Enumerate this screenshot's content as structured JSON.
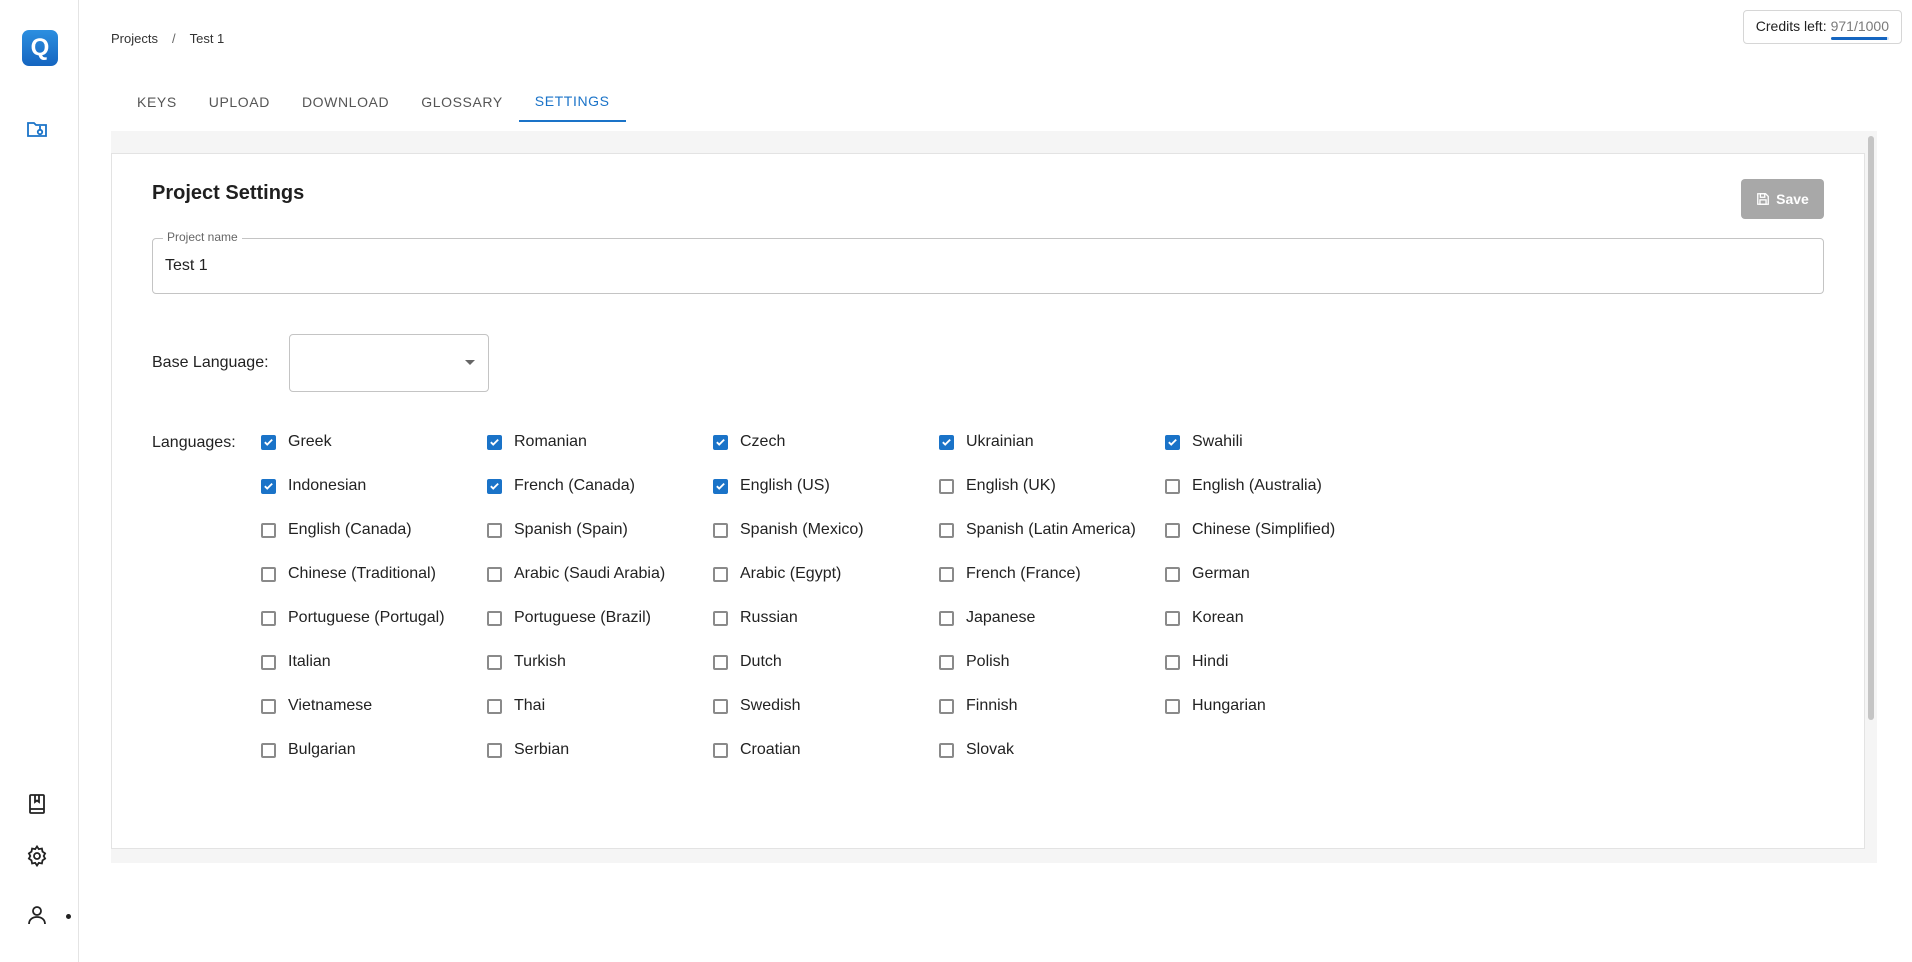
{
  "app": {
    "logo_letter": "Q"
  },
  "breadcrumb": {
    "projects": "Projects",
    "separator": "/",
    "current": "Test 1"
  },
  "credits": {
    "label": "Credits left:",
    "value": "971/1000",
    "fraction_used": 0.971
  },
  "tabs": [
    {
      "label": "KEYS",
      "active": false
    },
    {
      "label": "UPLOAD",
      "active": false
    },
    {
      "label": "DOWNLOAD",
      "active": false
    },
    {
      "label": "GLOSSARY",
      "active": false
    },
    {
      "label": "SETTINGS",
      "active": true
    }
  ],
  "settings": {
    "title": "Project Settings",
    "save_label": "Save",
    "project_name_legend": "Project name",
    "project_name_value": "Test 1",
    "base_language_label": "Base Language:",
    "base_language_value": "",
    "languages_label": "Languages:"
  },
  "languages": [
    {
      "name": "Greek",
      "checked": true
    },
    {
      "name": "Romanian",
      "checked": true
    },
    {
      "name": "Czech",
      "checked": true
    },
    {
      "name": "Ukrainian",
      "checked": true
    },
    {
      "name": "Swahili",
      "checked": true
    },
    {
      "name": "Indonesian",
      "checked": true
    },
    {
      "name": "French (Canada)",
      "checked": true
    },
    {
      "name": "English (US)",
      "checked": true
    },
    {
      "name": "English (UK)",
      "checked": false
    },
    {
      "name": "English (Australia)",
      "checked": false
    },
    {
      "name": "English (Canada)",
      "checked": false
    },
    {
      "name": "Spanish (Spain)",
      "checked": false
    },
    {
      "name": "Spanish (Mexico)",
      "checked": false
    },
    {
      "name": "Spanish (Latin America)",
      "checked": false
    },
    {
      "name": "Chinese (Simplified)",
      "checked": false
    },
    {
      "name": "Chinese (Traditional)",
      "checked": false
    },
    {
      "name": "Arabic (Saudi Arabia)",
      "checked": false
    },
    {
      "name": "Arabic (Egypt)",
      "checked": false
    },
    {
      "name": "French (France)",
      "checked": false
    },
    {
      "name": "German",
      "checked": false
    },
    {
      "name": "Portuguese (Portugal)",
      "checked": false
    },
    {
      "name": "Portuguese (Brazil)",
      "checked": false
    },
    {
      "name": "Russian",
      "checked": false
    },
    {
      "name": "Japanese",
      "checked": false
    },
    {
      "name": "Korean",
      "checked": false
    },
    {
      "name": "Italian",
      "checked": false
    },
    {
      "name": "Turkish",
      "checked": false
    },
    {
      "name": "Dutch",
      "checked": false
    },
    {
      "name": "Polish",
      "checked": false
    },
    {
      "name": "Hindi",
      "checked": false
    },
    {
      "name": "Vietnamese",
      "checked": false
    },
    {
      "name": "Thai",
      "checked": false
    },
    {
      "name": "Swedish",
      "checked": false
    },
    {
      "name": "Finnish",
      "checked": false
    },
    {
      "name": "Hungarian",
      "checked": false
    },
    {
      "name": "Bulgarian",
      "checked": false
    },
    {
      "name": "Serbian",
      "checked": false
    },
    {
      "name": "Croatian",
      "checked": false
    },
    {
      "name": "Slovak",
      "checked": false
    }
  ],
  "icons": {
    "folder": "folder-icon",
    "book": "book-icon",
    "settings": "gear-icon",
    "user": "user-icon",
    "save": "floppy-disk-icon"
  },
  "colors": {
    "accent": "#1a73c8",
    "logo": "#1e78d2",
    "save_disabled": "#a8a8a8"
  }
}
